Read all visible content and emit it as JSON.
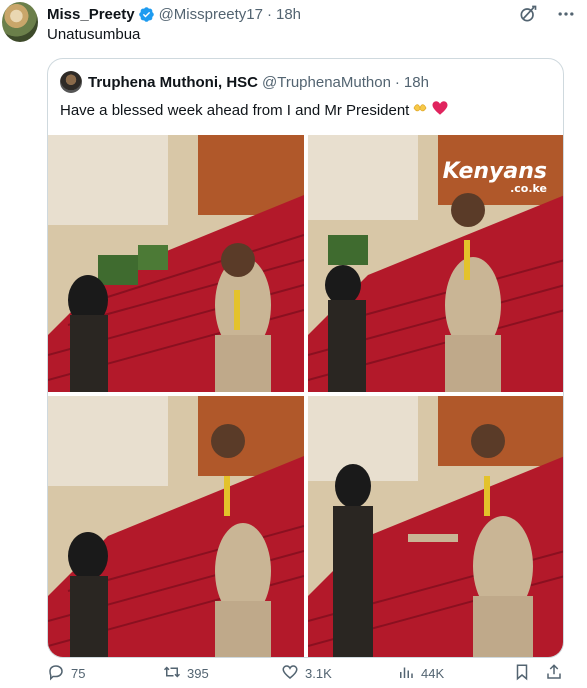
{
  "tweet": {
    "author_name": "Miss_Preety",
    "author_handle": "@Misspreety17",
    "separator": "·",
    "time": "18h",
    "text": "Unatusumbua"
  },
  "quote": {
    "author_name": "Truphena Muthoni, HSC",
    "author_handle": "@TruphenaMuthon",
    "separator": "·",
    "time": "18h",
    "text": "Have a blessed week ahead from I and Mr President",
    "emojis": [
      "folded-hands-yellow",
      "red-heart"
    ]
  },
  "media": {
    "watermark_main": "Kenyans",
    "watermark_sub": ".co.ke",
    "photos": [
      "photo-1",
      "photo-2",
      "photo-3",
      "photo-4"
    ]
  },
  "actions": {
    "replies": "75",
    "reposts": "395",
    "likes": "3.1K",
    "views": "44K"
  },
  "icons": {
    "verified": "verified-badge-icon",
    "grok": "grok-icon",
    "more": "more-icon",
    "reply": "reply-icon",
    "repost": "repost-icon",
    "like": "like-icon",
    "views": "views-icon",
    "bookmark": "bookmark-icon",
    "share": "share-icon"
  },
  "colors": {
    "verified_blue": "#1d9bf0",
    "text_primary": "#0f1419",
    "text_secondary": "#536471",
    "border": "#cfd9de",
    "carpet_red": "#b3192a"
  }
}
